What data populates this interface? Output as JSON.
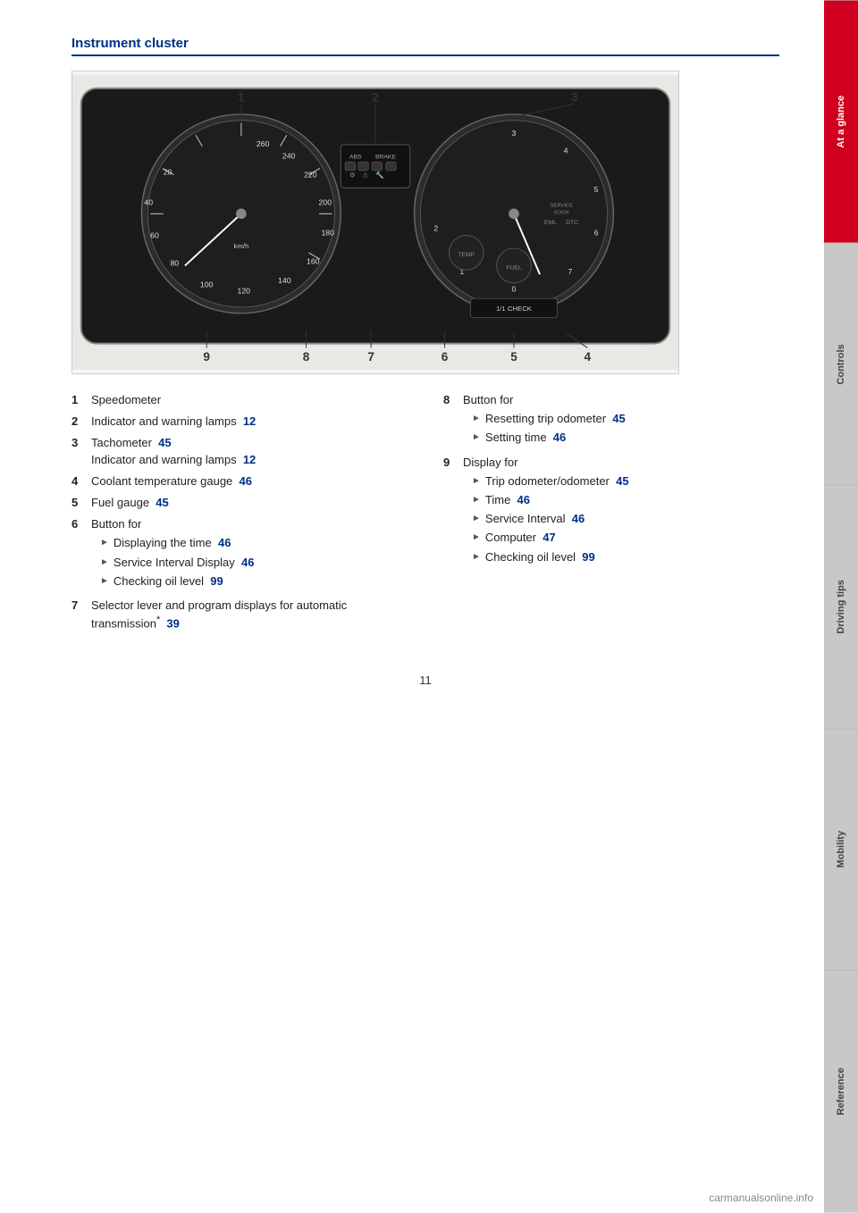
{
  "page": {
    "number": "11",
    "site": "carmanualsonline.info"
  },
  "sidebar": {
    "tabs": [
      {
        "id": "at-a-glance",
        "label": "At a glance",
        "active": true,
        "highlight": false
      },
      {
        "id": "controls",
        "label": "Controls",
        "active": false,
        "highlight": false
      },
      {
        "id": "driving-tips",
        "label": "Driving tips",
        "active": false,
        "highlight": false
      },
      {
        "id": "mobility",
        "label": "Mobility",
        "active": false,
        "highlight": false
      },
      {
        "id": "reference",
        "label": "Reference",
        "active": false,
        "highlight": false
      }
    ]
  },
  "section": {
    "title": "Instrument cluster"
  },
  "items_left": [
    {
      "num": "1",
      "text": "Speedometer",
      "sub_items": []
    },
    {
      "num": "2",
      "text": "Indicator and warning lamps",
      "page_ref": "12",
      "sub_items": []
    },
    {
      "num": "3",
      "text": "Tachometer",
      "page_ref": "45",
      "sub_items": [
        {
          "text": "Indicator and warning lamps",
          "page_ref": "12"
        }
      ]
    },
    {
      "num": "4",
      "text": "Coolant temperature gauge",
      "page_ref": "46",
      "sub_items": []
    },
    {
      "num": "5",
      "text": "Fuel gauge",
      "page_ref": "45",
      "sub_items": []
    },
    {
      "num": "6",
      "text": "Button for",
      "sub_items": [
        {
          "text": "Displaying the time",
          "page_ref": "46"
        },
        {
          "text": "Service Interval Display",
          "page_ref": "46"
        },
        {
          "text": "Checking oil level",
          "page_ref": "99"
        }
      ]
    },
    {
      "num": "7",
      "text": "Selector lever and program displays for automatic transmission",
      "asterisk": true,
      "page_ref": "39",
      "sub_items": []
    }
  ],
  "items_right": [
    {
      "num": "8",
      "text": "Button for",
      "sub_items": [
        {
          "text": "Resetting trip odometer",
          "page_ref": "45"
        },
        {
          "text": "Setting time",
          "page_ref": "46"
        }
      ]
    },
    {
      "num": "9",
      "text": "Display for",
      "sub_items": [
        {
          "text": "Trip odometer/odometer",
          "page_ref": "45"
        },
        {
          "text": "Time",
          "page_ref": "46"
        },
        {
          "text": "Service Interval",
          "page_ref": "46"
        },
        {
          "text": "Computer",
          "page_ref": "47"
        },
        {
          "text": "Checking oil level",
          "page_ref": "99"
        }
      ]
    }
  ],
  "cluster_labels": {
    "top_numbers": [
      "1",
      "2",
      "3"
    ],
    "bottom_numbers": [
      "9",
      "8",
      "7",
      "6",
      "5",
      "4"
    ]
  }
}
